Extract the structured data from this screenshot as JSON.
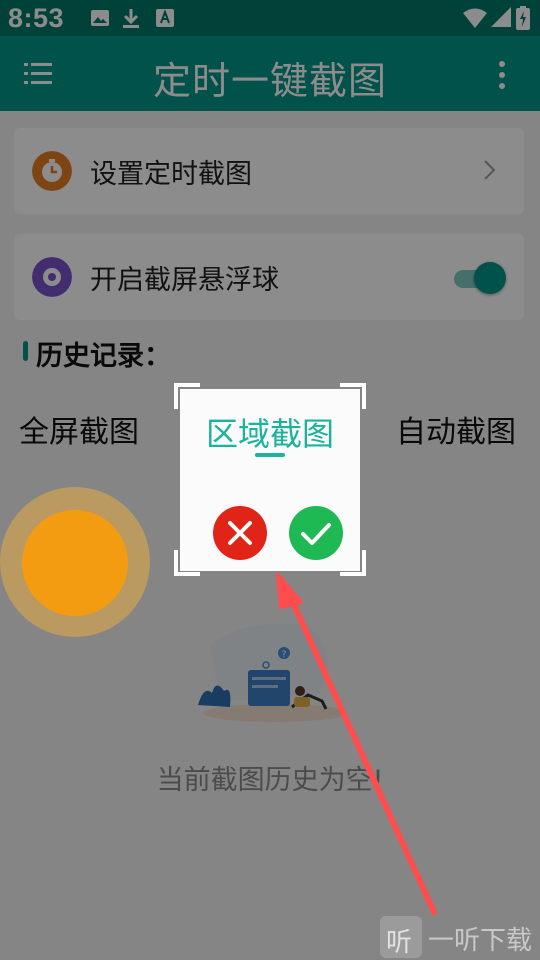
{
  "status_bar": {
    "time": "8:53",
    "left_icons": [
      "image-icon",
      "download-icon",
      "keyboard-a-icon"
    ],
    "right_icons": [
      "wifi-icon",
      "signal-icon",
      "battery-charging-icon"
    ]
  },
  "toolbar": {
    "title": "定时一键截图",
    "menu_icon": "menu-icon",
    "more_icon": "more-vert-icon"
  },
  "cards": {
    "timer": {
      "label": "设置定时截图",
      "icon": "timer-icon",
      "icon_color": "#e67e22"
    },
    "float": {
      "label": "开启截屏悬浮球",
      "icon": "disc-icon",
      "icon_color": "#7b52c9",
      "toggle_on": true
    }
  },
  "history": {
    "title": "历史记录：",
    "fullscreen_label": "全屏截图",
    "auto_label": "自动截图",
    "empty_text": "当前截图历史为空!"
  },
  "region_popup": {
    "title": "区域截图",
    "cancel_icon": "close-icon",
    "confirm_icon": "check-icon"
  },
  "floating_ball": {
    "color": "#f39c12"
  },
  "watermark": {
    "icon_text": "听",
    "text": "一听下载"
  },
  "colors": {
    "accent": "#009688",
    "accent_dark": "#00796b",
    "cancel": "#e02418",
    "confirm": "#1fb954",
    "arrow": "#ff4d4d"
  }
}
